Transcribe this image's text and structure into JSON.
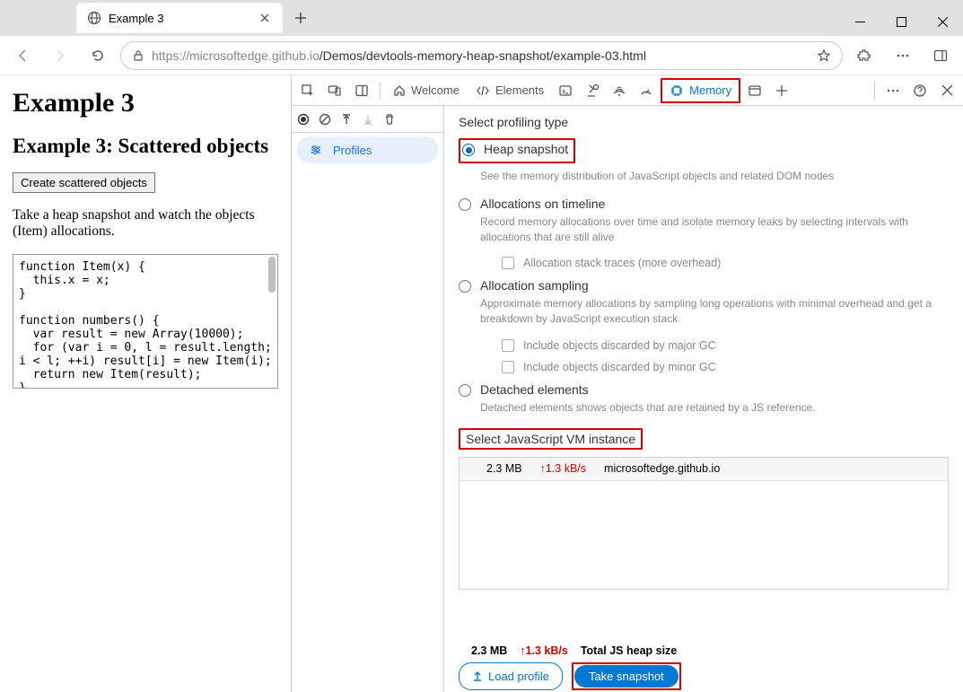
{
  "browser": {
    "tab_title": "Example 3",
    "url_host": "https://microsoftedge.github.io",
    "url_path": "/Demos/devtools-memory-heap-snapshot/example-03.html"
  },
  "page": {
    "h1": "Example 3",
    "h2": "Example 3: Scattered objects",
    "button": "Create scattered objects",
    "para": "Take a heap snapshot and watch the objects (Item) allocations.",
    "code": "function Item(x) {\n  this.x = x;\n}\n\nfunction numbers() {\n  var result = new Array(10000);\n  for (var i = 0, l = result.length;\ni < l; ++i) result[i] = new Item(i);\n  return new Item(result);\n}"
  },
  "devtools": {
    "tabs": {
      "welcome": "Welcome",
      "elements": "Elements",
      "memory": "Memory"
    },
    "sidebar": {
      "profiles": "Profiles"
    },
    "profiling": {
      "title": "Select profiling type",
      "heap": {
        "label": "Heap snapshot",
        "desc": "See the memory distribution of JavaScript objects and related DOM nodes"
      },
      "timeline": {
        "label": "Allocations on timeline",
        "desc": "Record memory allocations over time and isolate memory leaks by selecting intervals with allocations that are still alive",
        "cb1": "Allocation stack traces (more overhead)"
      },
      "sampling": {
        "label": "Allocation sampling",
        "desc": "Approximate memory allocations by sampling long operations with minimal overhead and get a breakdown by JavaScript execution stack",
        "cb1": "Include objects discarded by major GC",
        "cb2": "Include objects discarded by minor GC"
      },
      "detached": {
        "label": "Detached elements",
        "desc": "Detached elements shows objects that are retained by a JS reference."
      }
    },
    "vm": {
      "title": "Select JavaScript VM instance",
      "row": {
        "size": "2.3 MB",
        "rate": "↑1.3 kB/s",
        "name": "microsoftedge.github.io"
      }
    },
    "footer": {
      "size": "2.3 MB",
      "rate": "↑1.3 kB/s",
      "label": "Total JS heap size",
      "load": "Load profile",
      "snapshot": "Take snapshot"
    }
  }
}
